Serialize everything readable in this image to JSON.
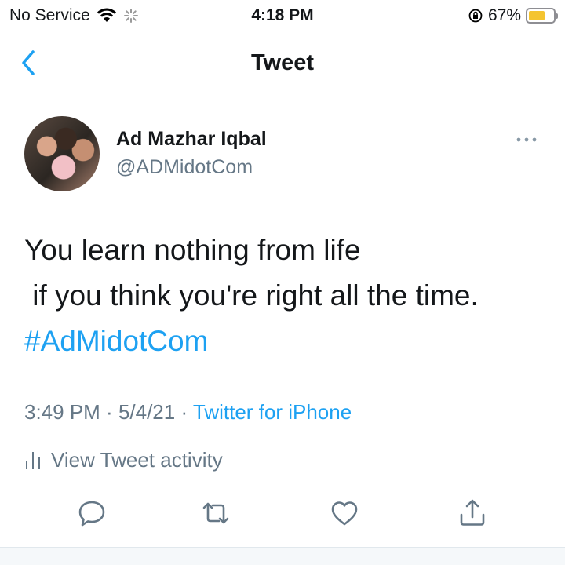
{
  "status_bar": {
    "carrier": "No Service",
    "time": "4:18 PM",
    "battery_percent": "67%",
    "battery_level": 0.67,
    "battery_color": "#f4c430"
  },
  "nav": {
    "title": "Tweet",
    "back_icon": "chevron-left-icon"
  },
  "tweet": {
    "display_name": "Ad Mazhar Iqbal",
    "handle": "@ADMidotCom",
    "text_line1": "You learn nothing from life",
    "text_line2": " if you think you're right all the time.",
    "hashtag": "#AdMidotCom",
    "time": "3:49 PM",
    "separator": " · ",
    "date": "5/4/21",
    "source": "Twitter for iPhone",
    "activity_label": "View Tweet activity"
  },
  "actions": [
    "reply-icon",
    "retweet-icon",
    "like-icon",
    "share-icon"
  ],
  "colors": {
    "accent": "#1da1f2",
    "secondary_text": "#657786"
  }
}
